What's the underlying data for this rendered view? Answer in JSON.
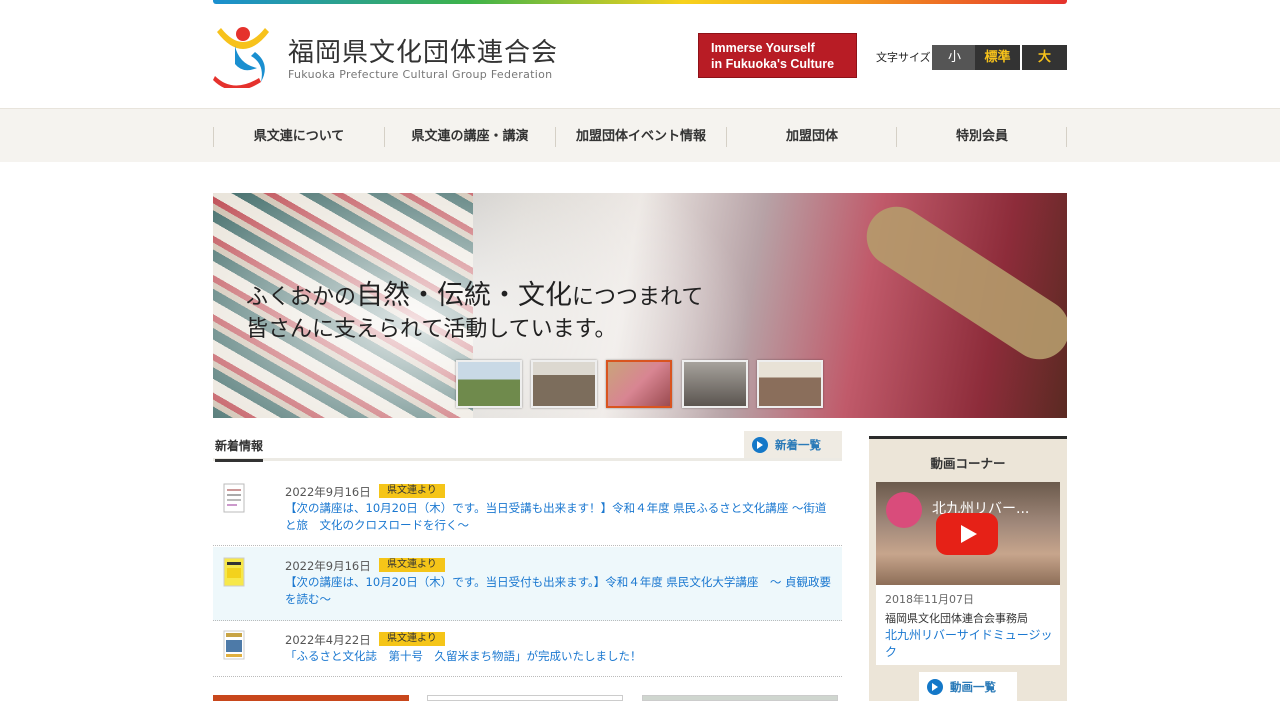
{
  "header": {
    "logo_jp": "福岡県文化団体連合会",
    "logo_en": "Fukuoka Prefecture Cultural Group Federation",
    "banner_line1": "Immerse Yourself",
    "banner_line2": "in Fukuoka's Culture",
    "font_size_label": "文字サイズ",
    "font_small": "小",
    "font_standard": "標準",
    "font_large": "大"
  },
  "nav": {
    "items": [
      "県文連について",
      "県文連の講座・講演",
      "加盟団体イベント情報",
      "加盟団体",
      "特別会員"
    ]
  },
  "hero": {
    "line1_a": "ふくおかの",
    "line1_b": "自然・伝統・文化",
    "line1_c": "につつまれて",
    "line2": "皆さんに支えられて活動しています。"
  },
  "news": {
    "title": "新着情報",
    "list_button": "新着一覧",
    "items": [
      {
        "date": "2022年9月16日",
        "tag": "県文連より",
        "text": "【次の講座は、10月20日（木）です。当日受講も出来ます！】令和４年度 県民ふるさと文化講座 ～街道と旅　文化のクロスロードを行く～"
      },
      {
        "date": "2022年9月16日",
        "tag": "県文連より",
        "text": "【次の講座は、10月20日（木）です。当日受付も出来ます。】令和４年度 県民文化大学講座　～ 貞観政要を読む～"
      },
      {
        "date": "2022年4月22日",
        "tag": "県文連より",
        "text": "「ふるさと文化誌　第十号　久留米まち物語」が完成いたしました！"
      }
    ]
  },
  "sidebar": {
    "title": "動画コーナー",
    "video_title": "北九州リバー...",
    "date": "2018年11月07日",
    "org": "福岡県文化団体連合会事務局",
    "link": "北九州リバーサイドミュージック",
    "list_button": "動画一覧"
  },
  "colors": {
    "accent_red": "#b81c25",
    "tag_yellow": "#f5c518",
    "link_blue": "#1b78d0"
  }
}
